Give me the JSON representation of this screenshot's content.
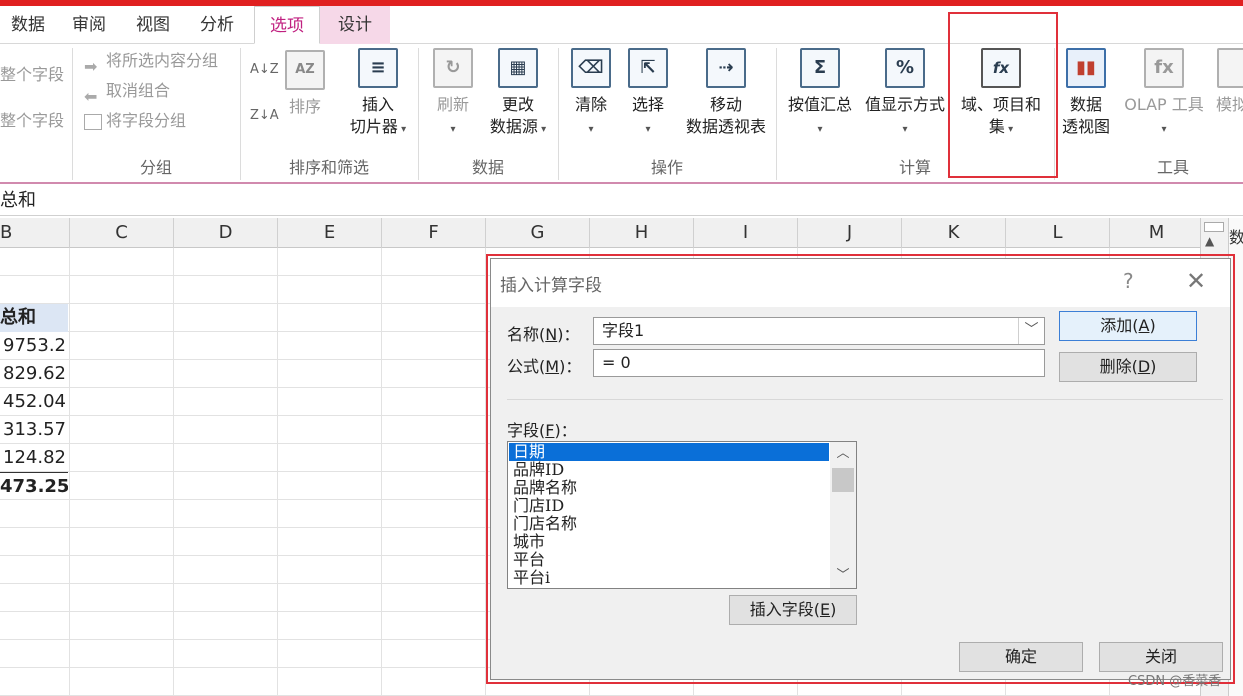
{
  "tabs": [
    {
      "label": "数据"
    },
    {
      "label": "审阅"
    },
    {
      "label": "视图"
    },
    {
      "label": "分析"
    },
    {
      "label": "选项"
    },
    {
      "label": "设计"
    }
  ],
  "ribbon": {
    "group_field": {
      "items": [
        "整个字段",
        "整个字段"
      ]
    },
    "group_group": {
      "label": "分组",
      "items": [
        "将所选内容分组",
        "取消组合",
        "将字段分组"
      ]
    },
    "group_sort": {
      "label": "排序和筛选",
      "sort_label": "排序",
      "slicer_line1": "插入",
      "slicer_line2": "切片器"
    },
    "group_data": {
      "label": "数据",
      "refresh_label": "刷新",
      "change_line1": "更改",
      "change_line2": "数据源"
    },
    "group_actions": {
      "label": "操作",
      "clear_label": "清除",
      "select_label": "选择",
      "move_line1": "移动",
      "move_line2": "数据透视表"
    },
    "group_calc": {
      "label": "计算",
      "summarize_label": "按值汇总",
      "show_values_label": "值显示方式",
      "fields_line1": "域、项目和",
      "fields_line2": "集"
    },
    "group_tools": {
      "label": "工具",
      "pivotchart_line1": "数据",
      "pivotchart_line2": "透视图",
      "olap_label": "OLAP 工具",
      "whatif_label": "模拟"
    }
  },
  "formula_bar": {
    "text": "总和"
  },
  "columns": [
    "B",
    "C",
    "D",
    "E",
    "F",
    "G",
    "H",
    "I",
    "J",
    "K",
    "L",
    "M"
  ],
  "cells_b": {
    "header": "总和",
    "values": [
      "9753.2",
      "829.62",
      "452.04",
      "313.57",
      "124.82"
    ],
    "total": "473.25"
  },
  "right_panel_label": "数",
  "dialog": {
    "title": "插入计算字段",
    "help": "?",
    "close_glyph": "✕",
    "name_label": "名称",
    "name_key": "N",
    "name_value": "字段1",
    "formula_label": "公式",
    "formula_key": "M",
    "formula_value": "= 0",
    "add_label": "添加",
    "add_key": "A",
    "delete_label": "删除",
    "delete_key": "D",
    "fields_label": "字段",
    "fields_key": "F",
    "fields": [
      "日期",
      "品牌ID",
      "品牌名称",
      "门店ID",
      "门店名称",
      "城市",
      "平台",
      "平台i"
    ],
    "insert_field_label": "插入字段",
    "insert_field_key": "E",
    "ok_label": "确定",
    "close_label": "关闭"
  },
  "watermark": "CSDN @香菜香"
}
